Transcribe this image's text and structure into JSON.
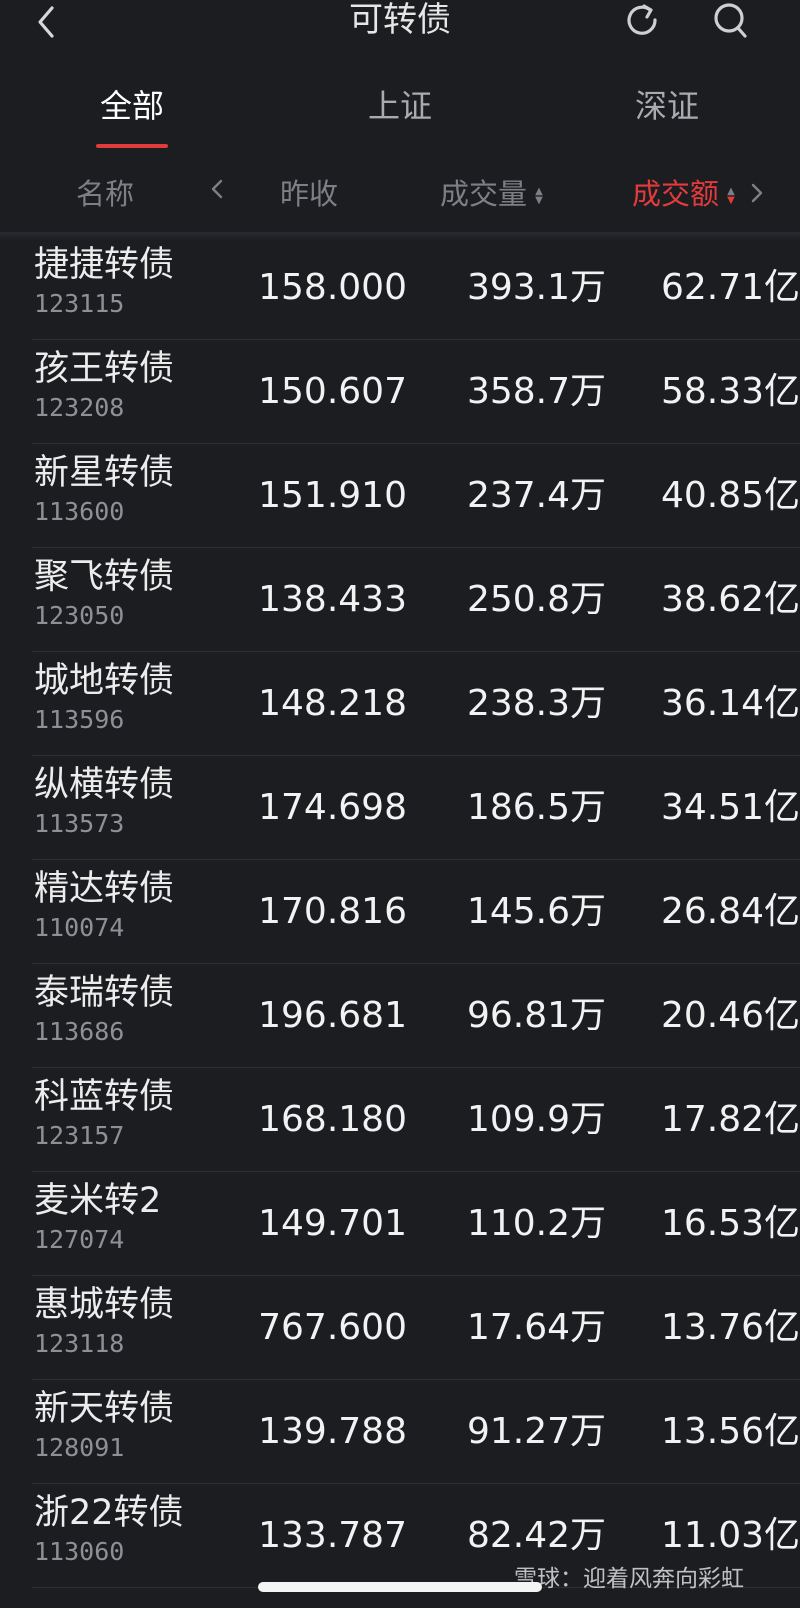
{
  "header": {
    "title": "可转债"
  },
  "tabs": [
    {
      "label": "全部"
    },
    {
      "label": "上证"
    },
    {
      "label": "深证"
    }
  ],
  "columns": {
    "name": "名称",
    "prev_close": "昨收",
    "volume": "成交量",
    "amount": "成交额"
  },
  "sort": {
    "active_column": "成交额",
    "direction": "descending"
  },
  "colors": {
    "accent": "#e23b3b",
    "background": "#1c1d21"
  },
  "icons": [
    "back-icon",
    "refresh-icon",
    "search-icon",
    "left-arrow-icon",
    "right-arrow-icon"
  ],
  "rows": [
    {
      "name": "捷捷转债",
      "code": "123115",
      "prev_close": "158.000",
      "volume": "393.1万",
      "amount": "62.71亿"
    },
    {
      "name": "孩王转债",
      "code": "123208",
      "prev_close": "150.607",
      "volume": "358.7万",
      "amount": "58.33亿"
    },
    {
      "name": "新星转债",
      "code": "113600",
      "prev_close": "151.910",
      "volume": "237.4万",
      "amount": "40.85亿"
    },
    {
      "name": "聚飞转债",
      "code": "123050",
      "prev_close": "138.433",
      "volume": "250.8万",
      "amount": "38.62亿"
    },
    {
      "name": "城地转债",
      "code": "113596",
      "prev_close": "148.218",
      "volume": "238.3万",
      "amount": "36.14亿"
    },
    {
      "name": "纵横转债",
      "code": "113573",
      "prev_close": "174.698",
      "volume": "186.5万",
      "amount": "34.51亿"
    },
    {
      "name": "精达转债",
      "code": "110074",
      "prev_close": "170.816",
      "volume": "145.6万",
      "amount": "26.84亿"
    },
    {
      "name": "泰瑞转债",
      "code": "113686",
      "prev_close": "196.681",
      "volume": "96.81万",
      "amount": "20.46亿"
    },
    {
      "name": "科蓝转债",
      "code": "123157",
      "prev_close": "168.180",
      "volume": "109.9万",
      "amount": "17.82亿"
    },
    {
      "name": "麦米转2",
      "code": "127074",
      "prev_close": "149.701",
      "volume": "110.2万",
      "amount": "16.53亿"
    },
    {
      "name": "惠城转债",
      "code": "123118",
      "prev_close": "767.600",
      "volume": "17.64万",
      "amount": "13.76亿"
    },
    {
      "name": "新天转债",
      "code": "128091",
      "prev_close": "139.788",
      "volume": "91.27万",
      "amount": "13.56亿"
    },
    {
      "name": "浙22转债",
      "code": "113060",
      "prev_close": "133.787",
      "volume": "82.42万",
      "amount": "11.03亿"
    }
  ],
  "watermark": "雪球：迎着风奔向彩虹"
}
